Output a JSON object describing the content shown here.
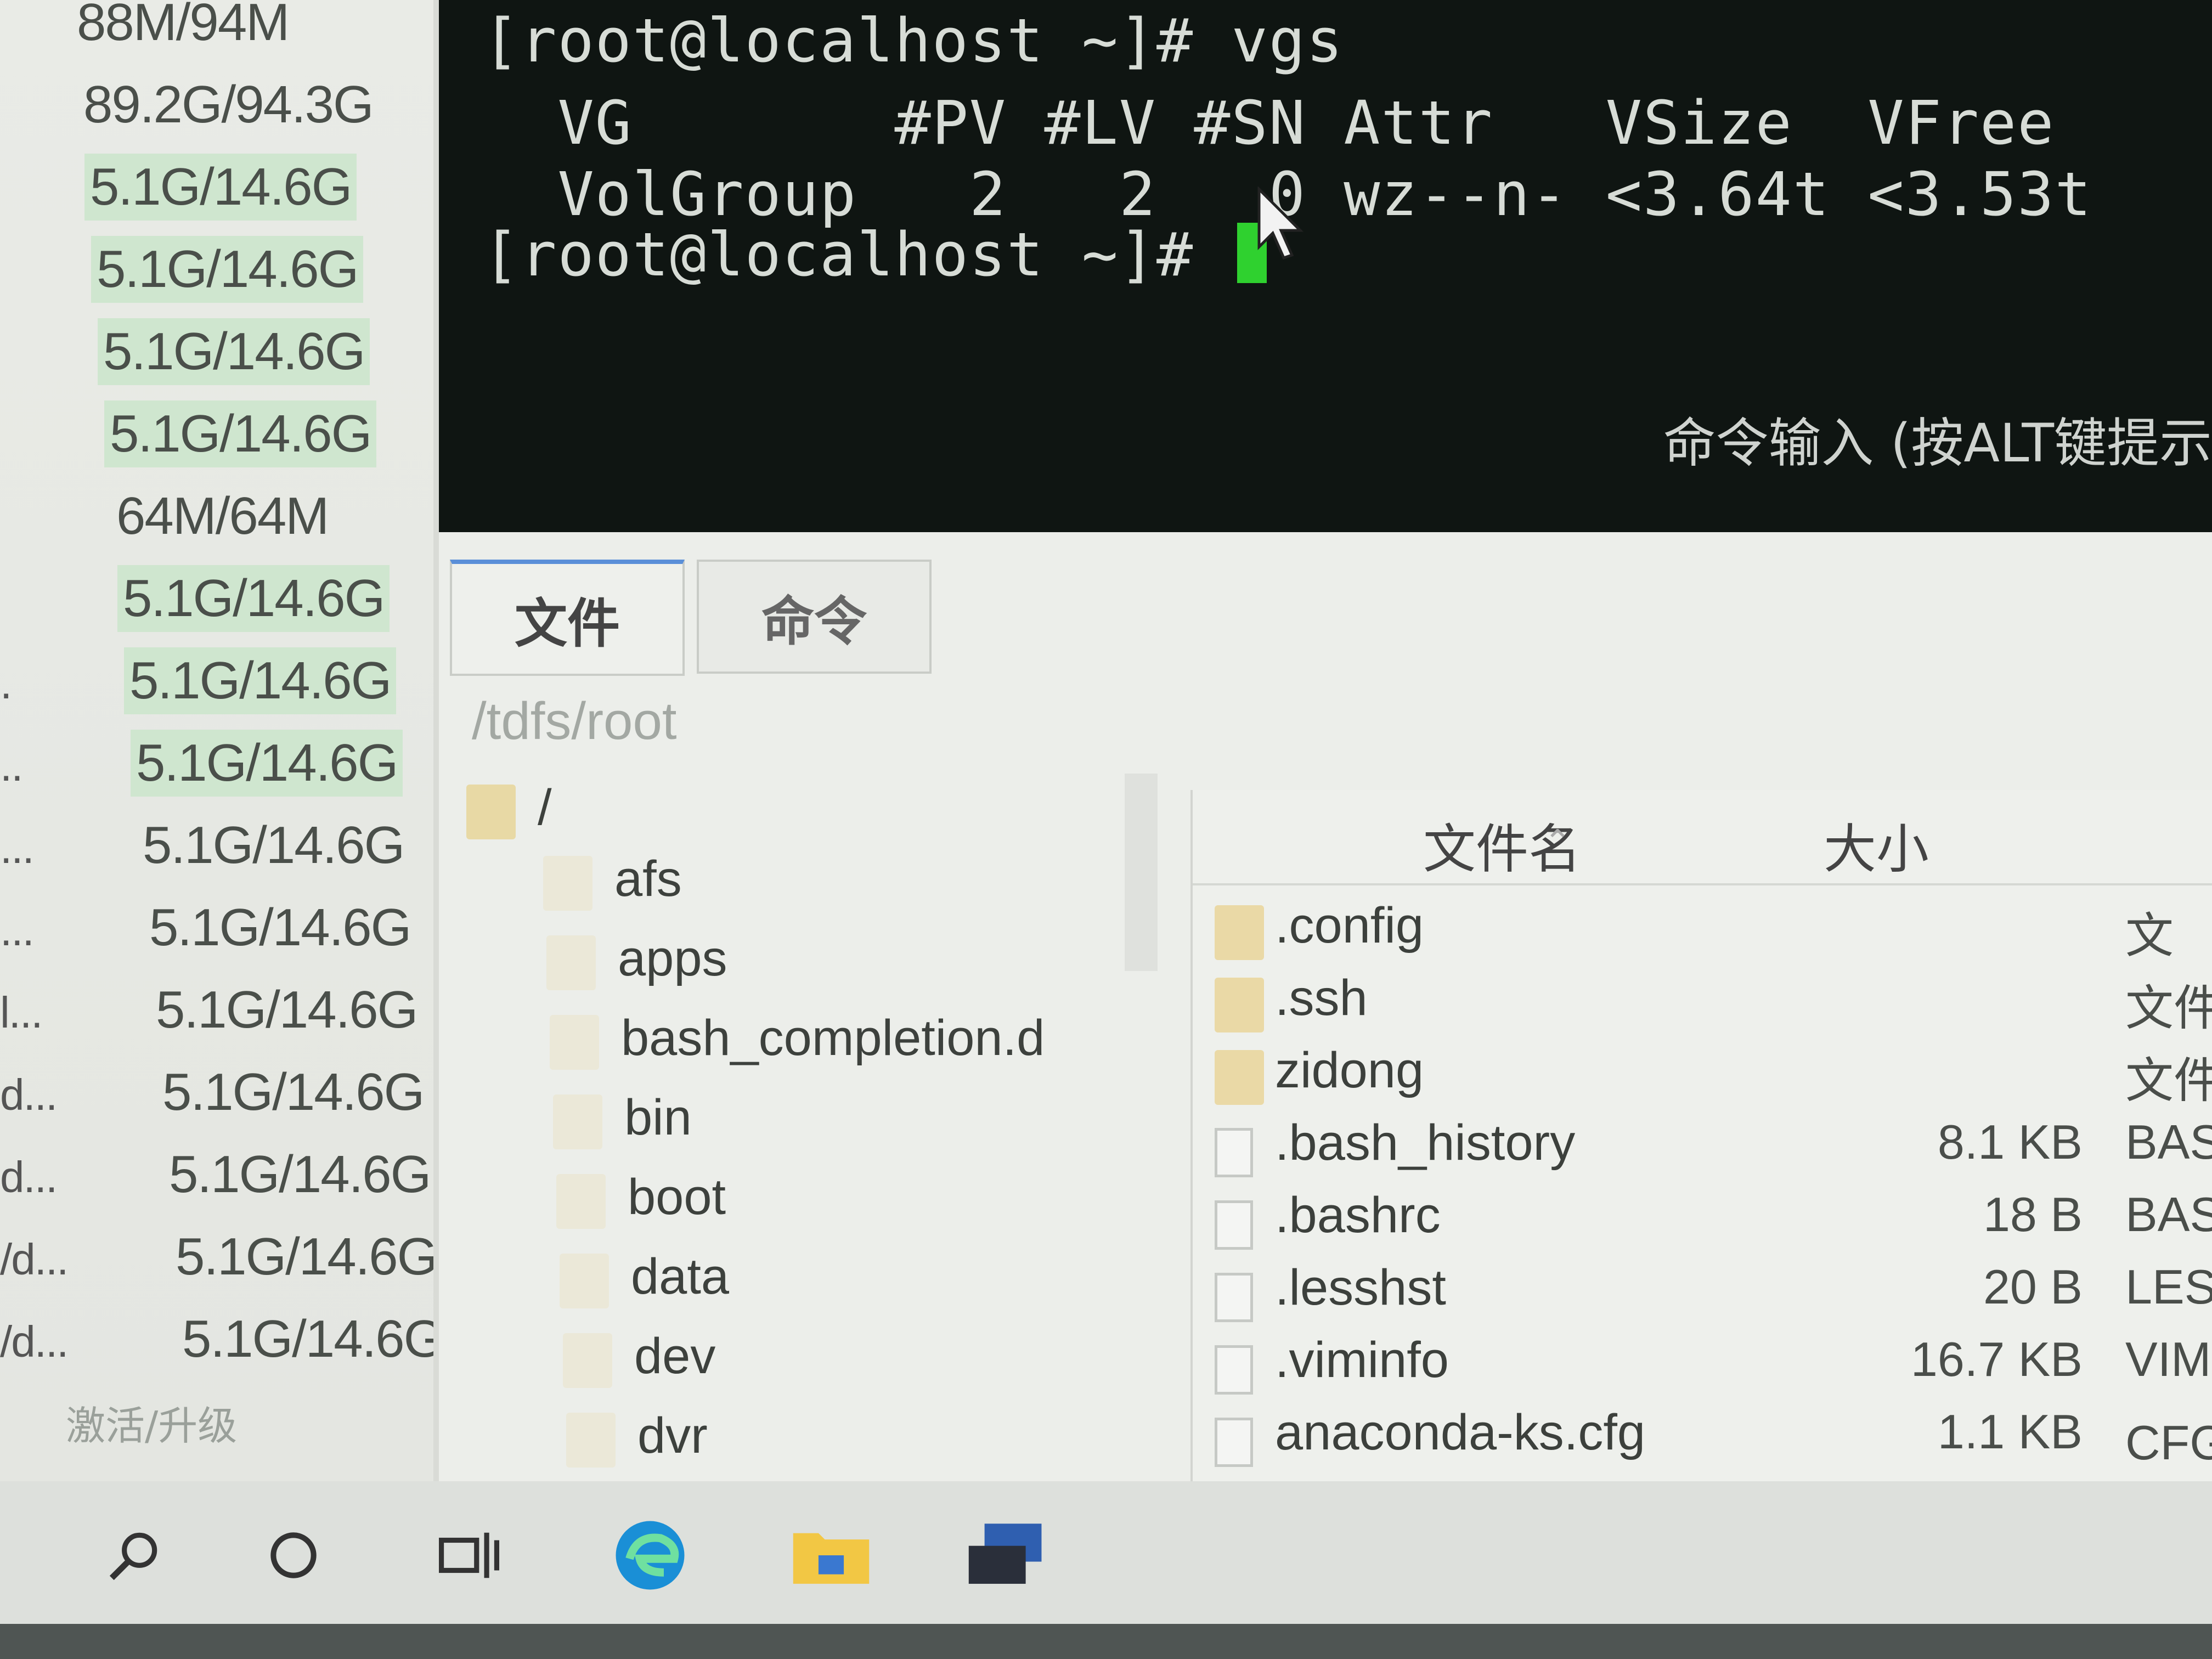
{
  "left_panel": {
    "rows": [
      {
        "trunc": "",
        "value": "88M/94M",
        "highlight": false
      },
      {
        "trunc": "",
        "value": "89.2G/94.3G",
        "highlight": false
      },
      {
        "trunc": "",
        "value": "5.1G/14.6G",
        "highlight": true
      },
      {
        "trunc": "",
        "value": "5.1G/14.6G",
        "highlight": true
      },
      {
        "trunc": "",
        "value": "5.1G/14.6G",
        "highlight": true
      },
      {
        "trunc": "",
        "value": "5.1G/14.6G",
        "highlight": true
      },
      {
        "trunc": "",
        "value": "64M/64M",
        "highlight": false
      },
      {
        "trunc": "",
        "value": "5.1G/14.6G",
        "highlight": true
      },
      {
        "trunc": ".",
        "value": "5.1G/14.6G",
        "highlight": true
      },
      {
        "trunc": "..",
        "value": "5.1G/14.6G",
        "highlight": true
      },
      {
        "trunc": "...",
        "value": "5.1G/14.6G",
        "highlight": false
      },
      {
        "trunc": "...",
        "value": "5.1G/14.6G",
        "highlight": false
      },
      {
        "trunc": "l...",
        "value": "5.1G/14.6G",
        "highlight": false
      },
      {
        "trunc": "d...",
        "value": "5.1G/14.6G",
        "highlight": false
      },
      {
        "trunc": "d...",
        "value": "5.1G/14.6G",
        "highlight": false
      },
      {
        "trunc": "/d...",
        "value": "5.1G/14.6G",
        "highlight": false
      },
      {
        "trunc": "/d...",
        "value": "5.1G/14.6G",
        "highlight": false
      }
    ],
    "activate_label": "激活/升级"
  },
  "terminal": {
    "line1": "[root@localhost ~]# vgs",
    "line2": "  VG       #PV #LV #SN Attr   VSize  VFree",
    "line3": "  VolGroup   2   2   0 wz--n- <3.64t <3.53t",
    "prompt": "[root@localhost ~]# ",
    "hint": "命令输入 (按ALT键提示"
  },
  "tabs": {
    "file": "文件",
    "command": "命令"
  },
  "path": "/tdfs/root",
  "tree": {
    "root": "/",
    "items": [
      "afs",
      "apps",
      "bash_completion.d",
      "bin",
      "boot",
      "data",
      "dev",
      "dvr"
    ]
  },
  "filelist": {
    "col_name": "文件名",
    "col_size": "大小",
    "rows": [
      {
        "name": ".config",
        "size": "",
        "type": "文",
        "kind": "folder"
      },
      {
        "name": ".ssh",
        "size": "",
        "type": "文件",
        "kind": "folder"
      },
      {
        "name": "zidong",
        "size": "",
        "type": "文件",
        "kind": "folder"
      },
      {
        "name": ".bash_history",
        "size": "8.1 KB",
        "type": "BAS",
        "kind": "doc"
      },
      {
        "name": ".bashrc",
        "size": "18 B",
        "type": "BASH",
        "kind": "doc"
      },
      {
        "name": ".lesshst",
        "size": "20 B",
        "type": "LESS",
        "kind": "doc"
      },
      {
        "name": ".viminfo",
        "size": "16.7 KB",
        "type": "VIMIN",
        "kind": "doc"
      },
      {
        "name": "anaconda-ks.cfg",
        "size": "1.1 KB",
        "type": "CFG 文",
        "kind": "doc"
      }
    ]
  },
  "taskbar": {
    "icons": [
      "search-icon",
      "cortana-circle-icon",
      "task-view-icon",
      "edge-browser-icon",
      "file-explorer-icon",
      "terminal-app-icon"
    ],
    "colors": {
      "accent": "#3a78d0",
      "cursor": "#2fd12f",
      "terminal_bg": "#0f1512"
    }
  }
}
